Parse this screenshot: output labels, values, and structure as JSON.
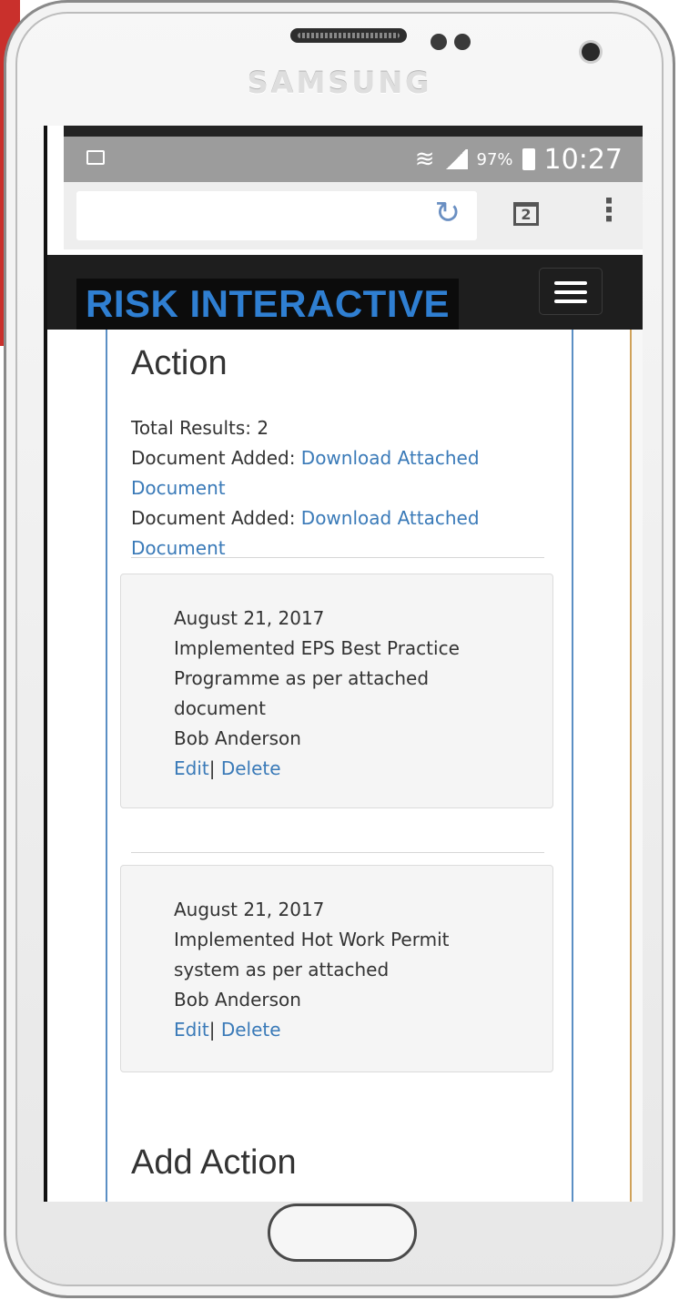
{
  "device": {
    "brand": "SAMSUNG"
  },
  "status_bar": {
    "notification_icon": "image-icon",
    "wifi_icon": "wifi-icon",
    "signal_icon": "signal-icon",
    "battery_percent": "97%",
    "battery_icon": "battery-icon",
    "time": "10:27"
  },
  "browser": {
    "url_value": "",
    "reload_icon": "reload-icon",
    "tab_count": "2",
    "menu_icon": "overflow-menu-icon"
  },
  "navbar": {
    "logo": "RISK INTERACTIVE",
    "menu_icon": "hamburger-icon"
  },
  "main": {
    "title": "Action",
    "total_results": "Total Results: 2",
    "documents": [
      {
        "prefix": "Document Added: ",
        "link": "Download Attached",
        "link2": "Document"
      },
      {
        "prefix": "Document Added: ",
        "link": "Download Attached",
        "link2": "Document"
      }
    ],
    "actions": [
      {
        "date": "August 21, 2017",
        "description_lines": [
          "Implemented EPS Best Practice",
          "Programme as per attached",
          "document"
        ],
        "author": "Bob Anderson",
        "edit": "Edit",
        "separator": "|",
        "delete": "Delete"
      },
      {
        "date": "August 21, 2017",
        "description_lines": [
          "Implemented Hot Work Permit",
          "system as per attached"
        ],
        "author": "Bob Anderson",
        "edit": "Edit",
        "separator": "|",
        "delete": "Delete"
      }
    ],
    "add_title": "Add Action"
  }
}
